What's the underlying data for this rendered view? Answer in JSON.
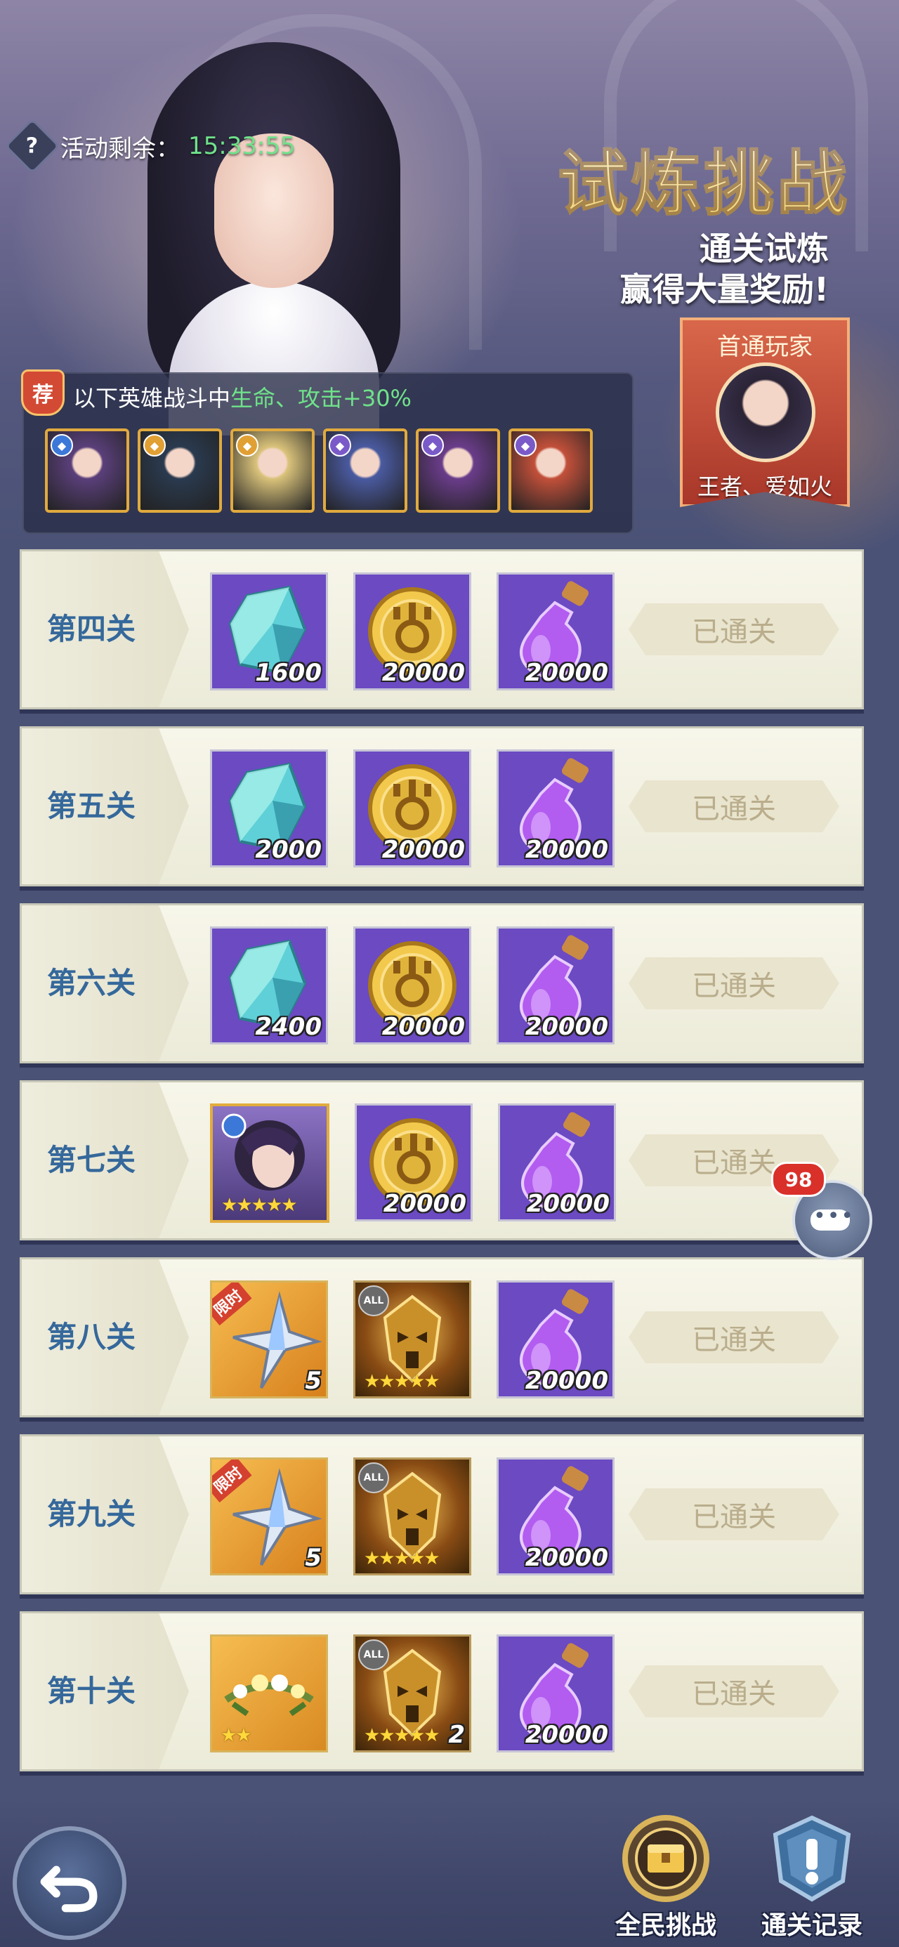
{
  "header": {
    "timer_label": "活动剩余：",
    "timer_value": "15:33:55",
    "title": "试炼挑战",
    "subtitle_line1": "通关试炼",
    "subtitle_line2": "赢得大量奖励!",
    "first_clear": {
      "title": "首通玩家",
      "player_name": "王者、爱如火"
    }
  },
  "buff": {
    "badge": "荐",
    "text_prefix": "以下英雄战斗中",
    "text_highlight": "生命、攻击+30%",
    "heroes": [
      {
        "element": "water-icon",
        "color": "#3c78d8",
        "portrait_color": "#5a3f7a"
      },
      {
        "element": "light-icon",
        "color": "#e0a033",
        "portrait_color": "#2a3a4f"
      },
      {
        "element": "light-icon",
        "color": "#e0a033",
        "portrait_color": "#d9c27a"
      },
      {
        "element": "dark-icon",
        "color": "#7a5ac8",
        "portrait_color": "#4a5aa0"
      },
      {
        "element": "dark-icon",
        "color": "#7a5ac8",
        "portrait_color": "#6a3c8a"
      },
      {
        "element": "dark-icon",
        "color": "#7a5ac8",
        "portrait_color": "#c2503a"
      }
    ]
  },
  "stages": [
    {
      "label": "第四关",
      "status": "已通关",
      "items": [
        {
          "type": "crystal",
          "count": "1600"
        },
        {
          "type": "gold-coin",
          "count": "20000"
        },
        {
          "type": "potion",
          "count": "20000"
        }
      ]
    },
    {
      "label": "第五关",
      "status": "已通关",
      "items": [
        {
          "type": "crystal",
          "count": "2000"
        },
        {
          "type": "gold-coin",
          "count": "20000"
        },
        {
          "type": "potion",
          "count": "20000"
        }
      ]
    },
    {
      "label": "第六关",
      "status": "已通关",
      "items": [
        {
          "type": "crystal",
          "count": "2400"
        },
        {
          "type": "gold-coin",
          "count": "20000"
        },
        {
          "type": "potion",
          "count": "20000"
        }
      ]
    },
    {
      "label": "第七关",
      "status": "已通关",
      "items": [
        {
          "type": "hero-card",
          "stars": "★★★★★"
        },
        {
          "type": "gold-coin",
          "count": "20000"
        },
        {
          "type": "potion",
          "count": "20000"
        }
      ]
    },
    {
      "label": "第八关",
      "status": "已通关",
      "items": [
        {
          "type": "limited-shard",
          "tag": "限时",
          "count": "5"
        },
        {
          "type": "all-hero-mask",
          "tag": "ALL",
          "stars": "★★★★★"
        },
        {
          "type": "potion",
          "count": "20000"
        }
      ]
    },
    {
      "label": "第九关",
      "status": "已通关",
      "items": [
        {
          "type": "limited-shard",
          "tag": "限时",
          "count": "5"
        },
        {
          "type": "all-hero-mask",
          "tag": "ALL",
          "stars": "★★★★★"
        },
        {
          "type": "potion",
          "count": "20000"
        }
      ]
    },
    {
      "label": "第十关",
      "status": "已通关",
      "items": [
        {
          "type": "flower-crown",
          "stars": "★★"
        },
        {
          "type": "all-hero-mask",
          "tag": "ALL",
          "stars": "★★★★★",
          "count": "2"
        },
        {
          "type": "potion",
          "count": "20000"
        }
      ]
    }
  ],
  "chat": {
    "badge": "98"
  },
  "bottom": {
    "challenge_label": "全民挑战",
    "record_label": "通关记录"
  }
}
